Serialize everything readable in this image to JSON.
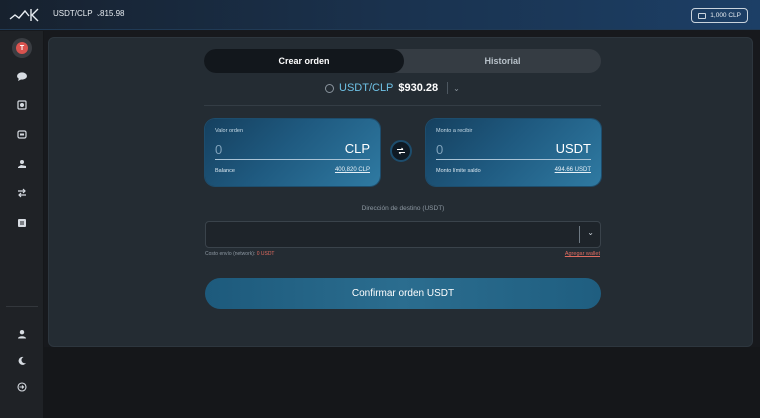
{
  "header": {
    "pair": "USDT/CLP",
    "price": "815.98",
    "balance_chip": "1,000 CLP"
  },
  "sidebar": {
    "items": [
      {
        "icon": "avatar-t-icon",
        "label": "T",
        "active": true
      },
      {
        "icon": "chat-bubbles-icon"
      },
      {
        "icon": "exchange-doc-icon"
      },
      {
        "icon": "wallet-icon"
      },
      {
        "icon": "coin-hand-icon"
      },
      {
        "icon": "swap-arrows-icon"
      },
      {
        "icon": "note-icon"
      }
    ],
    "bottom": [
      {
        "icon": "user-icon"
      },
      {
        "icon": "moon-icon"
      },
      {
        "icon": "logout-icon"
      }
    ]
  },
  "tabs": {
    "active": "Crear orden",
    "inactive": "Historial"
  },
  "pair_head": {
    "name": "USDT/CLP",
    "value": "$930.28"
  },
  "order_card": {
    "label": "Valor orden",
    "placeholder": "0",
    "currency": "CLP",
    "foot_label": "Balance",
    "foot_value": "400,820 CLP"
  },
  "receive_card": {
    "label": "Monto a recibir",
    "placeholder": "0",
    "currency": "USDT",
    "foot_label": "Monto límite saldo",
    "foot_value": "494.66 USDT"
  },
  "destination": {
    "label": "Dirección de destino (USDT)",
    "cost_label": "Costo envío (network):",
    "cost_value": "0 USDT",
    "add_wallet": "Agregar wallet"
  },
  "confirm_label": "Confirmar orden USDT",
  "colors": {
    "accent": "#6fc2e6",
    "danger": "#e06b5f",
    "card_from": "#15405f",
    "card_to": "#2f7aa2"
  }
}
